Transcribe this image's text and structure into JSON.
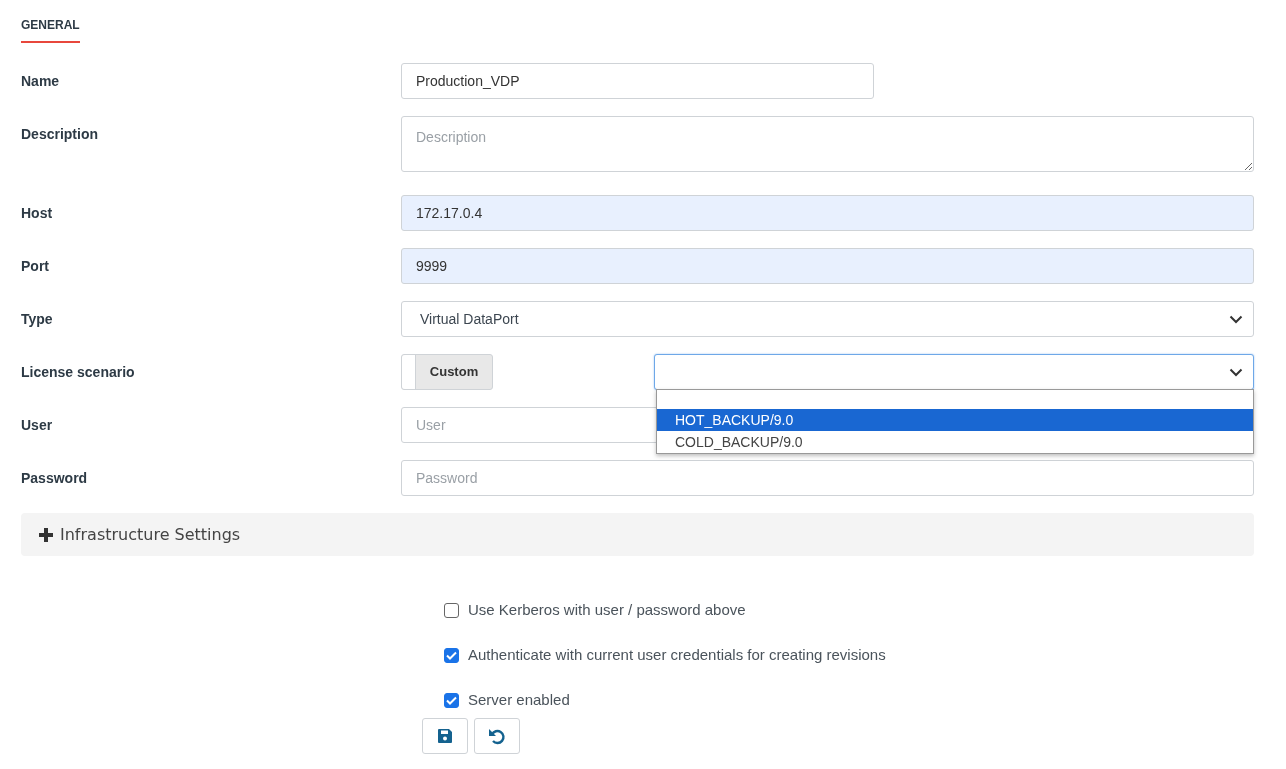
{
  "section_tab": {
    "label": "GENERAL",
    "selected": true
  },
  "fields": [
    {
      "kind": "text",
      "label": "Name",
      "value": "Production_VDP",
      "autofilled": false
    },
    {
      "kind": "textarea",
      "label": "Description",
      "placeholder": "Description"
    },
    {
      "kind": "text",
      "label": "Host",
      "value": "172.17.0.4",
      "autofilled": true
    },
    {
      "kind": "text",
      "label": "Port",
      "value": "9999",
      "autofilled": true
    },
    {
      "kind": "select",
      "label": "Type",
      "value": "Virtual DataPort"
    },
    {
      "kind": "license",
      "label": "License scenario",
      "toggle": {
        "label": "Custom",
        "on": false
      },
      "select": {
        "expanded": true,
        "options": [
          {
            "label": "HOT_BACKUP/9.0",
            "selected": true
          },
          {
            "label": "COLD_BACKUP/9.0",
            "selected": false
          }
        ]
      }
    },
    {
      "kind": "text",
      "label": "User",
      "placeholder": "User",
      "autofilled": false
    },
    {
      "kind": "password",
      "label": "Password",
      "placeholder": "Password",
      "autofilled": false
    }
  ],
  "collapsible": {
    "label": "Infrastructure Settings",
    "expanded": false
  },
  "checkboxes": [
    {
      "label": "Use Kerberos with user / password above",
      "checked": false
    },
    {
      "label": "Authenticate with current user credentials for creating revisions",
      "checked": true
    },
    {
      "label": "Server enabled",
      "checked": true
    }
  ],
  "actions": [
    {
      "kind": "save"
    },
    {
      "kind": "undo"
    }
  ]
}
